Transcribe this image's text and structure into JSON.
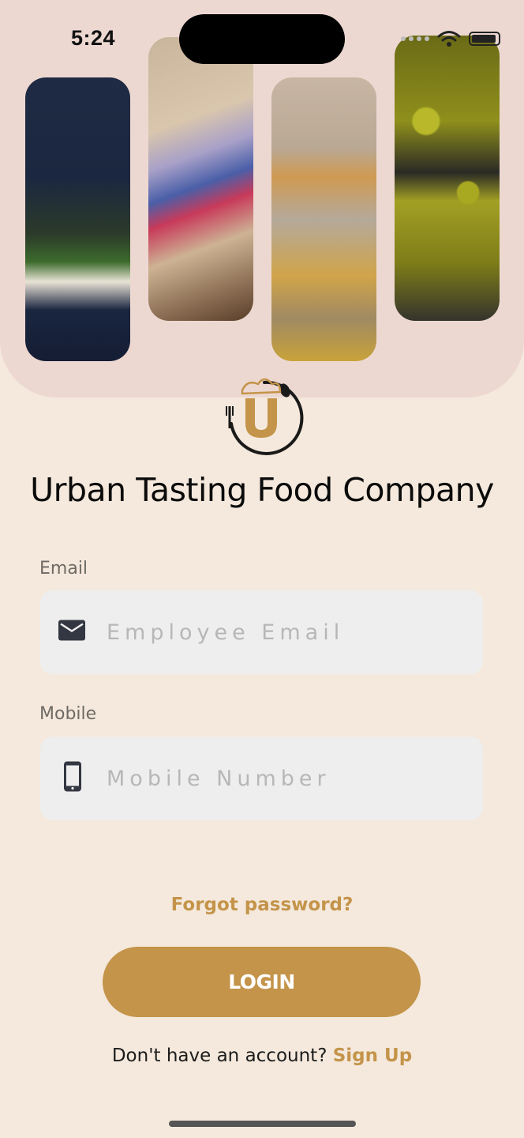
{
  "status_bar": {
    "time": "5:24"
  },
  "brand": {
    "name": "Urban Tasting Food Company",
    "logo_letter": "U"
  },
  "form": {
    "email": {
      "label": "Email",
      "placeholder": "Employee Email",
      "value": "",
      "icon": "mail-icon"
    },
    "mobile": {
      "label": "Mobile",
      "placeholder": "Mobile Number",
      "value": "",
      "icon": "phone-icon"
    },
    "forgot_label": "Forgot password?",
    "login_label": "LOGIN"
  },
  "signup": {
    "prompt": "Don't have an account?",
    "link_label": "Sign Up"
  },
  "colors": {
    "accent": "#c4944a",
    "hero_bg": "#edd8d1",
    "page_bg": "#f4e9dc",
    "input_bg": "#eeeeee"
  }
}
